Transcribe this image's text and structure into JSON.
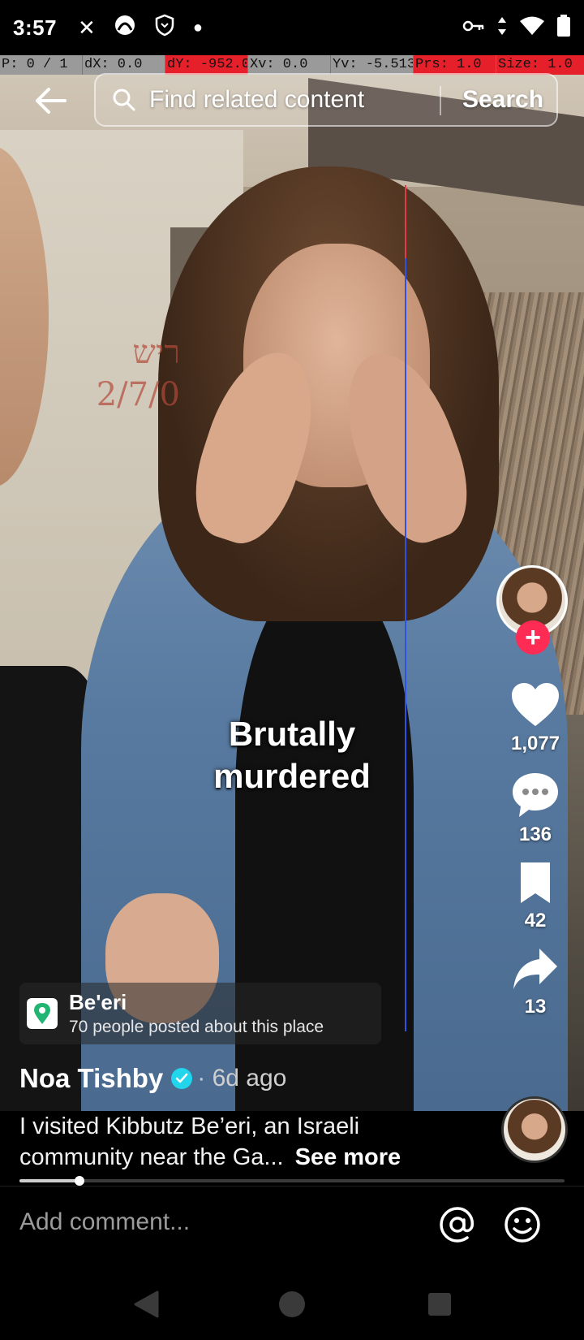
{
  "status_bar": {
    "time": "3:57",
    "icons": [
      "close-icon",
      "app-icon",
      "shield-icon",
      "dot-icon",
      "vpn-key-icon",
      "data-arrows-icon",
      "wifi-icon",
      "battery-icon"
    ]
  },
  "debug": {
    "pointer": "P: 0 / 1",
    "dx": "dX: 0.0",
    "dy": "dY: -952.0",
    "xv": "Xv: 0.0",
    "yv": "Yv: -5.513",
    "prs": "Prs: 1.0",
    "size": "Size: 1.0"
  },
  "topbar": {
    "search_placeholder": "Find related content",
    "search_button": "Search"
  },
  "video": {
    "caption_line1": "Brutally",
    "caption_line2": "murdered",
    "graffiti": "ריש\n2/7/0"
  },
  "rail": {
    "likes": "1,077",
    "comments": "136",
    "saves": "42",
    "shares": "13"
  },
  "location": {
    "place": "Be'eri",
    "posted": "70 people posted about this place"
  },
  "author": {
    "name": "Noa Tishby",
    "time_ago": "· 6d ago"
  },
  "description": {
    "line1": "I visited Kibbutz Be’eri, an Israeli",
    "line2": "community near the Ga...",
    "see_more": "See more"
  },
  "progress": {
    "fraction": 0.11
  },
  "comment_bar": {
    "placeholder": "Add comment..."
  },
  "colors": {
    "accent": "#fe2c55",
    "verified": "#20d5ec",
    "debug_red": "#e5202a"
  }
}
